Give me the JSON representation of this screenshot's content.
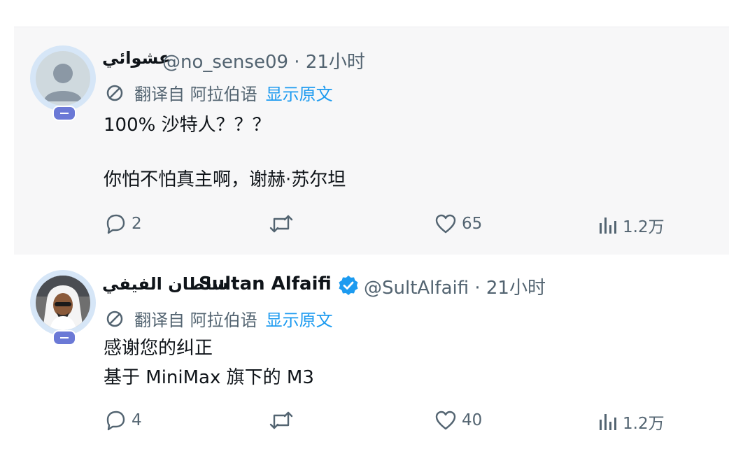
{
  "posts": [
    {
      "name": "عشوائي",
      "handle": "@no_sense09 · 21小时",
      "translate_label": "翻译自 阿拉伯语",
      "show_original": "显示原文",
      "body_line_1": "100% 沙特人？？？",
      "body_line_2": "你怕不怕真主啊，谢赫·苏尔坦",
      "reply_count": "2",
      "like_count": "65",
      "view_count": "1.2万"
    },
    {
      "name_arabic": "سلطان الفيفي",
      "name_latin": "Sultan Alfaifi",
      "handle": "@SultAlfaifi · 21小时",
      "translate_label": "翻译自 阿拉伯语",
      "show_original": "显示原文",
      "body_line_1": "感谢您的纠正",
      "body_line_2": "基于 MiniMax 旗下的 M3",
      "reply_count": "4",
      "like_count": "40",
      "view_count": "1.2万"
    }
  ],
  "colors": {
    "accent": "#1d9bf0",
    "muted": "#536471",
    "badge": "#6b79d6",
    "verified": "#1d9bf0"
  },
  "icons": [
    "reply-icon",
    "retweet-icon",
    "like-icon",
    "views-icon",
    "translate-icon",
    "verified-badge-icon"
  ]
}
